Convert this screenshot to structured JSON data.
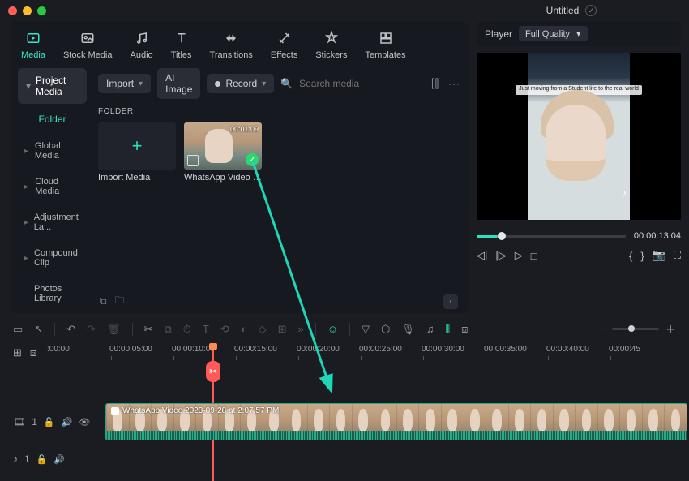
{
  "title": "Untitled",
  "tabs": [
    {
      "label": "Media",
      "icon": "media-icon",
      "active": true
    },
    {
      "label": "Stock Media",
      "icon": "stock-icon"
    },
    {
      "label": "Audio",
      "icon": "audio-icon"
    },
    {
      "label": "Titles",
      "icon": "titles-icon"
    },
    {
      "label": "Transitions",
      "icon": "transitions-icon"
    },
    {
      "label": "Effects",
      "icon": "effects-icon"
    },
    {
      "label": "Stickers",
      "icon": "stickers-icon"
    },
    {
      "label": "Templates",
      "icon": "templates-icon"
    }
  ],
  "sidebar": {
    "project_media": "Project Media",
    "folder": "Folder",
    "items": [
      {
        "label": "Global Media"
      },
      {
        "label": "Cloud Media"
      },
      {
        "label": "Adjustment La..."
      },
      {
        "label": "Compound Clip"
      }
    ],
    "photos_library": "Photos Library"
  },
  "toolbar": {
    "import": "Import",
    "ai_image": "AI Image",
    "record": "Record",
    "search_placeholder": "Search media"
  },
  "folder_heading": "FOLDER",
  "media": {
    "import_label": "Import Media",
    "clip": {
      "duration": "00:01:09",
      "label": "WhatsApp Video 202..."
    }
  },
  "player": {
    "label": "Player",
    "quality": "Full Quality",
    "caption": "Just moving from a Student life to the real world",
    "time": "00:00:13:04"
  },
  "ruler": [
    ":00:00",
    "00:00:05:00",
    "00:00:10:00",
    "00:00:15:00",
    "00:00:20:00",
    "00:00:25:00",
    "00:00:30:00",
    "00:00:35:00",
    "00:00:40:00",
    "00:00:45"
  ],
  "timeline_clip_label": "WhatsApp Video 2023-09-28 at 2:07:57 PM",
  "track_labels": {
    "video": "1",
    "audio": "1"
  },
  "colors": {
    "accent": "#2fe0bd",
    "playhead": "#ff5a55"
  }
}
